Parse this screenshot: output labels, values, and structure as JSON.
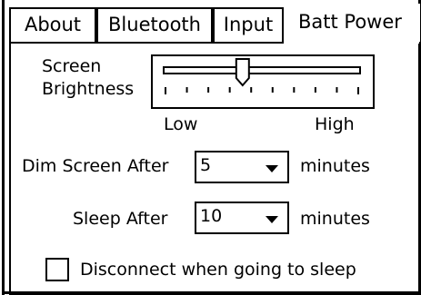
{
  "tabs": [
    {
      "label": "About",
      "active": false
    },
    {
      "label": "Bluetooth",
      "active": false
    },
    {
      "label": "Input",
      "active": false
    },
    {
      "label": "Batt Power",
      "active": true
    }
  ],
  "brightness": {
    "label_line1": "Screen",
    "label_line2": "Brightness",
    "low_label": "Low",
    "high_label": "High",
    "level_fraction": 0.4,
    "tick_count": 10
  },
  "dim_screen": {
    "label": "Dim Screen After",
    "value": "5",
    "unit": "minutes"
  },
  "sleep": {
    "label": "Sleep After",
    "value": "10",
    "unit": "minutes"
  },
  "disconnect": {
    "label": "Disconnect when going to sleep",
    "checked": false
  }
}
